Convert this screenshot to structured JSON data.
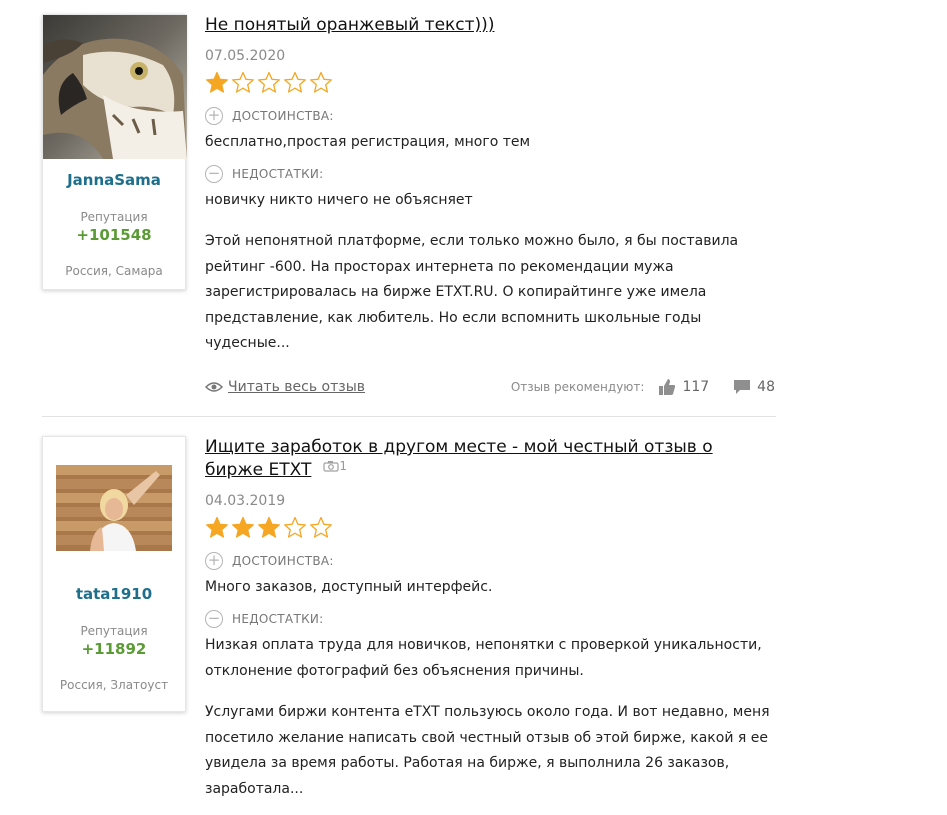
{
  "reviews": [
    {
      "author": {
        "name": "JannaSama",
        "reputation_label": "Репутация",
        "reputation": "+101548",
        "location": "Россия, Самара",
        "avatar": "hawk-photo"
      },
      "title": "Не понятый оранжевый текст)))",
      "date": "07.05.2020",
      "rating": 1,
      "pros_label": "ДОСТОИНСТВА:",
      "pros": "бесплатно,простая регистрация, много тем",
      "cons_label": "НЕДОСТАТКИ:",
      "cons": "новичку никто ничего не объясняет",
      "body": "Этой непонятной платформе, если только можно было, я бы поставила рейтинг -600. На просторах интернета по рекомендации мужа зарегистрировалась на бирже ETXT.RU. О копирайтинге уже имела представление, как любитель. Но если вспомнить школьные годы чудесные...",
      "read_more": "Читать весь отзыв",
      "recommend_label": "Отзыв рекомендуют:",
      "likes": "117",
      "comments": "48"
    },
    {
      "author": {
        "name": "tata1910",
        "reputation_label": "Репутация",
        "reputation": "+11892",
        "location": "Россия, Златоуст",
        "avatar": "woman-photo"
      },
      "title": "Ищите заработок в другом месте - мой честный отзыв о бирже ETXT",
      "photo_count": "1",
      "date": "04.03.2019",
      "rating": 3,
      "pros_label": "ДОСТОИНСТВА:",
      "pros": "Много заказов, доступный интерфейс.",
      "cons_label": "НЕДОСТАТКИ:",
      "cons": "Низкая оплата труда для новичков, непонятки с проверкой уникальности, отклонение фотографий без объяснения причины.",
      "body": "Услугами биржи контента eTXT пользуюсь около года. И вот недавно, меня посетило желание написать свой честный отзыв об этой бирже, какой я ее увидела за время работы. Работая на бирже, я выполнила 26 заказов, заработала..."
    }
  ],
  "colors": {
    "star_fill": "#f5a623",
    "author_link": "#1e6f8c",
    "reputation": "#5a9b35"
  }
}
